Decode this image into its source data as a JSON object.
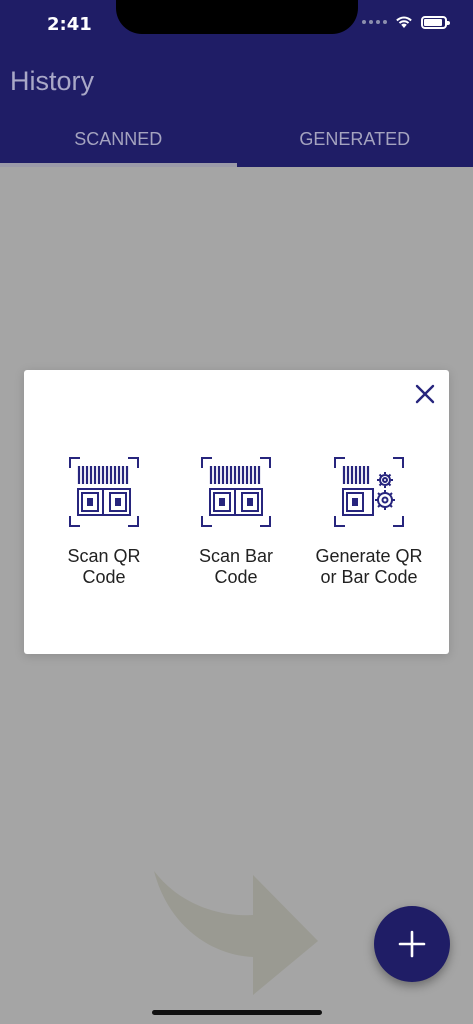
{
  "status_bar": {
    "time": "2:41",
    "battery_level": 0.9
  },
  "app_bar": {
    "title": "History"
  },
  "tabs": [
    {
      "label": "SCANNED",
      "active": true
    },
    {
      "label": "GENERATED",
      "active": false
    }
  ],
  "dialog": {
    "options": [
      {
        "label": "Scan QR\nCode",
        "icon": "scan-qr-icon"
      },
      {
        "label": "Scan Bar\nCode",
        "icon": "scan-barcode-icon"
      },
      {
        "label": "Generate QR\nor Bar Code",
        "icon": "generate-code-icon"
      }
    ]
  },
  "colors": {
    "primary": "#1f1d66",
    "icon": "#27257d",
    "overlay": "#a5a5a5"
  }
}
